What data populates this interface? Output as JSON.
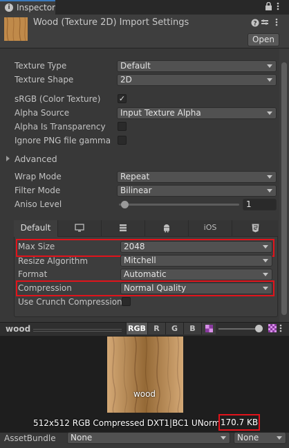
{
  "window": {
    "tab_label": "Inspector"
  },
  "header": {
    "title": "Wood (Texture 2D) Import Settings",
    "open_label": "Open"
  },
  "fields": {
    "texture_type": {
      "label": "Texture Type",
      "value": "Default"
    },
    "texture_shape": {
      "label": "Texture Shape",
      "value": "2D"
    },
    "srgb": {
      "label": "sRGB (Color Texture)",
      "checked": true
    },
    "alpha_source": {
      "label": "Alpha Source",
      "value": "Input Texture Alpha"
    },
    "alpha_transparency": {
      "label": "Alpha Is Transparency",
      "checked": false
    },
    "ignore_png_gamma": {
      "label": "Ignore PNG file gamma",
      "checked": false
    },
    "advanced": {
      "label": "Advanced"
    },
    "wrap_mode": {
      "label": "Wrap Mode",
      "value": "Repeat"
    },
    "filter_mode": {
      "label": "Filter Mode",
      "value": "Bilinear"
    },
    "aniso_level": {
      "label": "Aniso Level",
      "value": "1",
      "fraction": 0.0
    }
  },
  "platform": {
    "tabs": [
      {
        "label": "Default",
        "icon": "default"
      },
      {
        "label": "",
        "icon": "monitor-icon"
      },
      {
        "label": "",
        "icon": "grid-icon"
      },
      {
        "label": "",
        "icon": "android-icon"
      },
      {
        "label": "iOS",
        "icon": "ios"
      },
      {
        "label": "",
        "icon": "html5-icon"
      }
    ],
    "max_size": {
      "label": "Max Size",
      "value": "2048"
    },
    "resize_algorithm": {
      "label": "Resize Algorithm",
      "value": "Mitchell"
    },
    "format": {
      "label": "Format",
      "value": "Automatic"
    },
    "compression": {
      "label": "Compression",
      "value": "Normal Quality"
    },
    "crunch": {
      "label": "Use Crunch Compression",
      "checked": false
    }
  },
  "preview": {
    "name_label": "wood",
    "channels": [
      "RGB",
      "R",
      "G",
      "B"
    ],
    "texture_name": "wood",
    "info": "512x512  RGB Compressed DXT1|BC1 UNorm",
    "size": "170.7 KB"
  },
  "asset_bundle": {
    "label": "AssetBundle",
    "name_value": "None",
    "variant_value": "None"
  },
  "colors": {
    "highlight": "#e2131b",
    "accent": "#3a79bb",
    "background": "#383838"
  }
}
